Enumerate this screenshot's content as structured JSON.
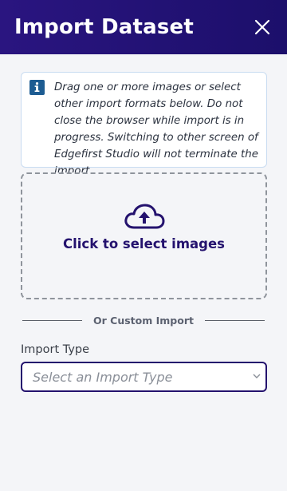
{
  "dialog": {
    "title": "Import Dataset",
    "close_icon": "close-icon"
  },
  "info": {
    "icon": "info-icon",
    "text": "Drag one or more images or select other import formats below. Do not close the browser while import is in progress. Switching to other screen of Edgefirst Studio will not terminate the import."
  },
  "dropzone": {
    "icon": "cloud-upload-icon",
    "label": "Click to select images"
  },
  "divider": {
    "text": "Or Custom Import"
  },
  "import_type": {
    "label": "Import Type",
    "placeholder": "Select an Import Type",
    "chevron_icon": "chevron-down-icon"
  },
  "colors": {
    "header": "#24126e",
    "accent": "#24126e",
    "info_icon": "#1d5c92",
    "background": "#f4f5f8"
  }
}
